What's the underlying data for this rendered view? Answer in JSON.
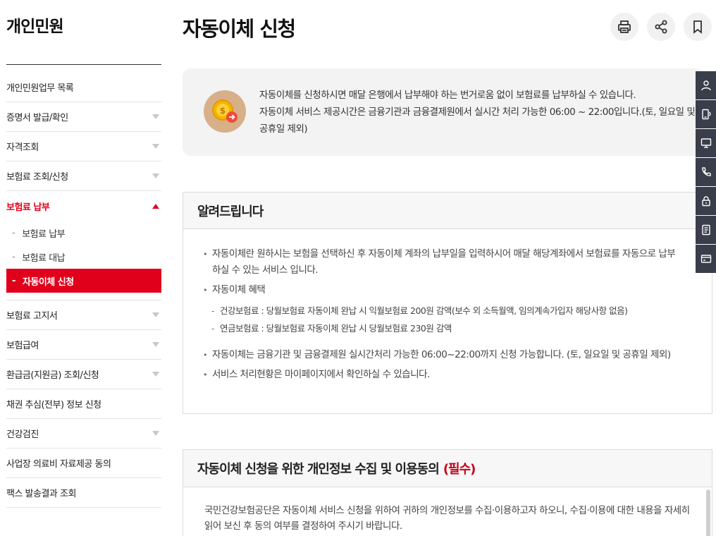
{
  "sidebar": {
    "title": "개인민원",
    "menu_before": [
      {
        "label": "개인민원업무 목록",
        "expandable": false
      },
      {
        "label": "증명서 발급/확인",
        "expandable": true
      },
      {
        "label": "자격조회",
        "expandable": true
      },
      {
        "label": "보험료 조회/신청",
        "expandable": true
      }
    ],
    "active_menu": {
      "label": "보험료 납부",
      "expanded": true
    },
    "submenu": [
      {
        "label": "보험료 납부",
        "selected": false
      },
      {
        "label": "보험료 대납",
        "selected": false
      },
      {
        "label": "자동이체 신청",
        "selected": true
      }
    ],
    "menu_after": [
      {
        "label": "보험료 고지서",
        "expandable": true
      },
      {
        "label": "보험급여",
        "expandable": true
      },
      {
        "label": "환급금(지원금) 조회/신청",
        "expandable": true
      },
      {
        "label": "채권 추심(전부) 정보 신청",
        "expandable": false
      },
      {
        "label": "건강검진",
        "expandable": true
      },
      {
        "label": "사업장 의료비 자료제공 동의",
        "expandable": false
      },
      {
        "label": "팩스 발송결과 조회",
        "expandable": false
      }
    ],
    "submenu_dash": "-"
  },
  "header": {
    "title": "자동이체 신청",
    "tools": [
      "print-icon",
      "share-icon",
      "bookmark-icon"
    ]
  },
  "intro": {
    "line1": "자동이체를 신청하시면 매달 은행에서 납부해야 하는 번거로움 없이 보험료를 납부하실 수 있습니다.",
    "line2": "자동이체 서비스 제공시간은 금융기관과 금융결제원에서 실시간 처리 가능한 06:00 ~ 22:00입니다.(토, 일요일 및 공휴일 제외)",
    "icon": "coin-transfer-icon"
  },
  "notice": {
    "title": "알려드립니다",
    "item1": "자동이체란 원하시는 보험을 선택하신 후 자동이체 계좌의 납부일을 입력하시어 매달 해당계좌에서 보험료를 자동으로 납부하실 수 있는 서비스 입니다.",
    "item2": "자동이체 혜택",
    "sub1": "건강보험료 : 당월보험료 자동이체 완납 시 익월보험료 200원 감액(보수 외 소득월액, 임의계속가입자 해당사항 없음)",
    "sub2": "연금보험료 : 당월보험료 자동이체 완납 시 당월보험료 230원 감액",
    "item3": "자동이체는 금융기관 및 금융결제원 실시간처리 가능한 06:00~22:00까지 신청 가능합니다. (토, 일요일 및 공휴일 제외)",
    "item4": "서비스 처리현황은 마이페이지에서 확인하실 수 있습니다.",
    "sub_dash": "-"
  },
  "consent": {
    "title": "자동이체 신청을 위한 개인정보 수집 및 이용동의",
    "required": "(필수)",
    "body": "국민건강보험공단은 자동이체 서비스 신청을 위하여 귀하의 개인정보를 수집·이용하고자 하오니, 수집·이용에 대한 내용을 자세히 읽어 보신 후 동의 여부를 결정하여 주시기 바랍니다."
  },
  "quickbar": [
    "user-icon",
    "mobile-certificate-icon",
    "monitor-icon",
    "phone-icon",
    "lock-icon",
    "document-icon",
    "card-icon"
  ],
  "colors": {
    "accent_red": "#e0001b",
    "quickbar_bg": "#3a3d4a",
    "coin_bg": "#d7b08a"
  }
}
